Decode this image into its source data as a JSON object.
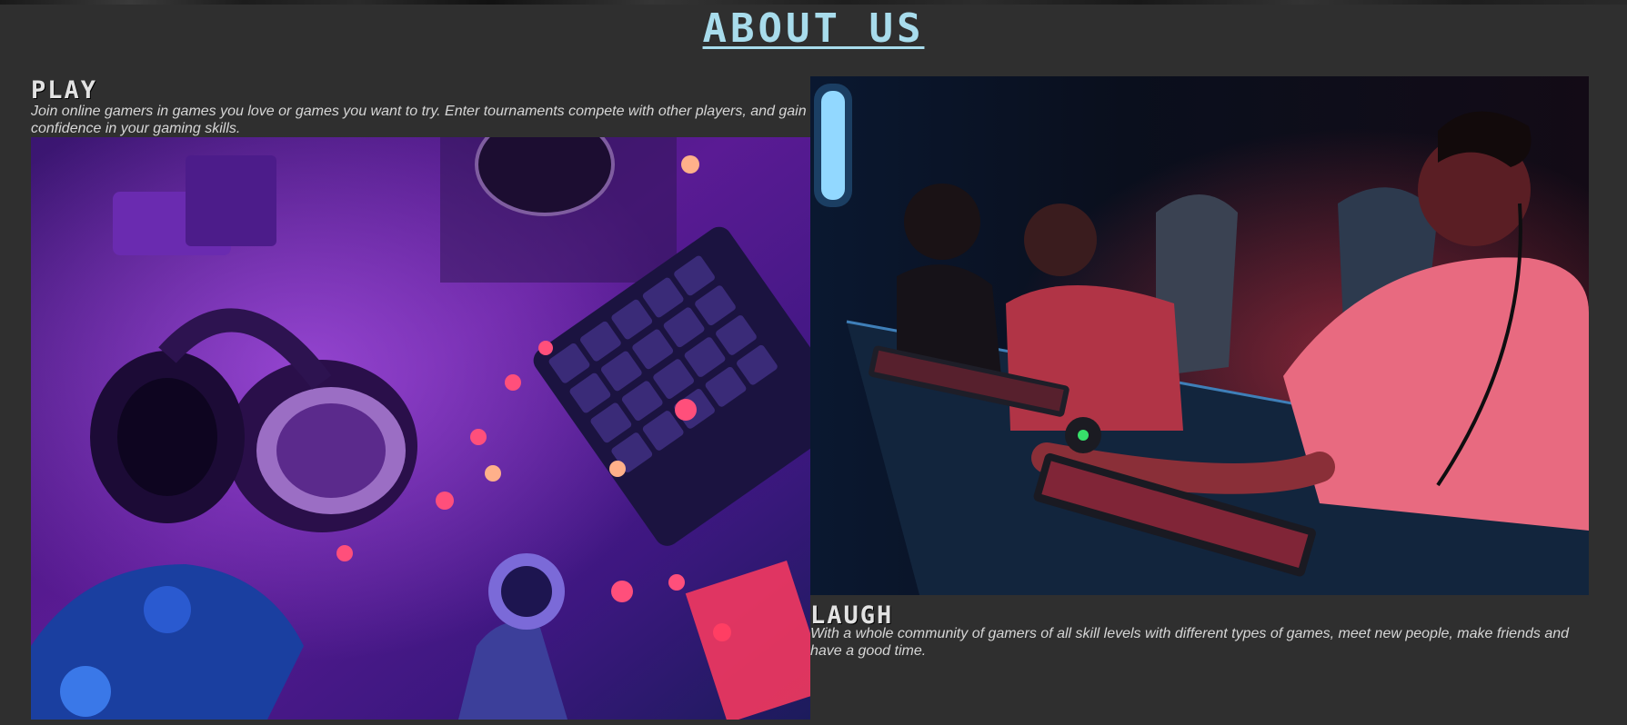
{
  "page": {
    "heading": "ABOUT US"
  },
  "sections": {
    "play": {
      "title": "PLAY",
      "text": "Join online gamers in games you love or games you want to try. Enter tournaments compete with other players, and gain confidence in your gaming skills.",
      "image": "gaming-desk-flatlay-image"
    },
    "laugh": {
      "title": "LAUGH",
      "text": "With a whole community of gamers of all skill levels with different types of games, meet new people, make friends and have a good time.",
      "image": "gamers-playing-image"
    }
  },
  "colors": {
    "background": "#2f2f2f",
    "heading": "#a8dcec",
    "title": "#e2e2e2",
    "text": "#d6d6d6"
  }
}
